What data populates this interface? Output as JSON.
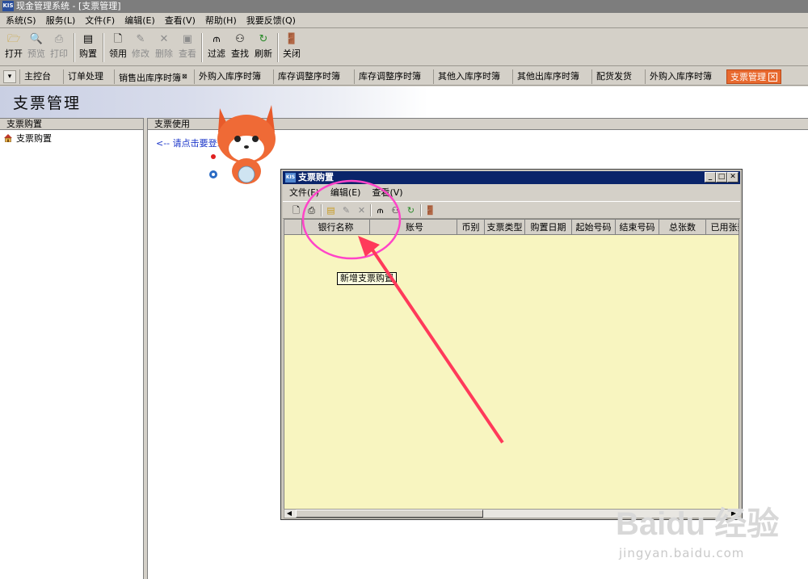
{
  "window": {
    "title": "现金管理系统 - [支票管理]"
  },
  "menubar": [
    {
      "label": "系统(S)"
    },
    {
      "label": "服务(L)"
    },
    {
      "label": "文件(F)"
    },
    {
      "label": "编辑(E)"
    },
    {
      "label": "查看(V)"
    },
    {
      "label": "帮助(H)"
    },
    {
      "label": "我要反馈(Q)"
    }
  ],
  "toolbar": {
    "open": "打开",
    "preview": "预览",
    "print": "打印",
    "purchase": "购置",
    "receive": "领用",
    "modify": "修改",
    "delete": "删除",
    "view": "查看",
    "filter": "过滤",
    "find": "查找",
    "refresh": "刷新",
    "close": "关闭"
  },
  "tabs": [
    {
      "label": "主控台"
    },
    {
      "label": "订单处理"
    },
    {
      "label": "销售出库序时簿"
    },
    {
      "label": "外购入库序时簿"
    },
    {
      "label": "库存调整序时簿"
    },
    {
      "label": "库存调整序时簿"
    },
    {
      "label": "其他入库序时簿"
    },
    {
      "label": "其他出库序时簿"
    },
    {
      "label": "配货发货"
    },
    {
      "label": "外购入库序时簿"
    },
    {
      "label": "支票管理",
      "active": true
    }
  ],
  "page": {
    "title": "支票管理"
  },
  "left_panel": {
    "header": "支票购置",
    "tree_item": "支票购置"
  },
  "right_panel": {
    "header": "支票使用",
    "hint": "<-- 请点击要登录的"
  },
  "dialog": {
    "title": "支票购置",
    "menu": [
      "文件(F)",
      "编辑(E)",
      "查看(V)"
    ],
    "tooltip": "新增支票购置",
    "columns": [
      "银行名称",
      "账号",
      "币别",
      "支票类型",
      "购置日期",
      "起始号码",
      "结束号码",
      "总张数",
      "已用张数"
    ]
  },
  "watermark": {
    "brand": "Baidu 经验",
    "url": "jingyan.baidu.com"
  },
  "colors": {
    "active_tab": "#e8692e",
    "dialog_titlebar": "#0a246a",
    "grid_background": "#f8f5c0",
    "annotation": "#ff3a7a",
    "link": "#1a35c9"
  }
}
